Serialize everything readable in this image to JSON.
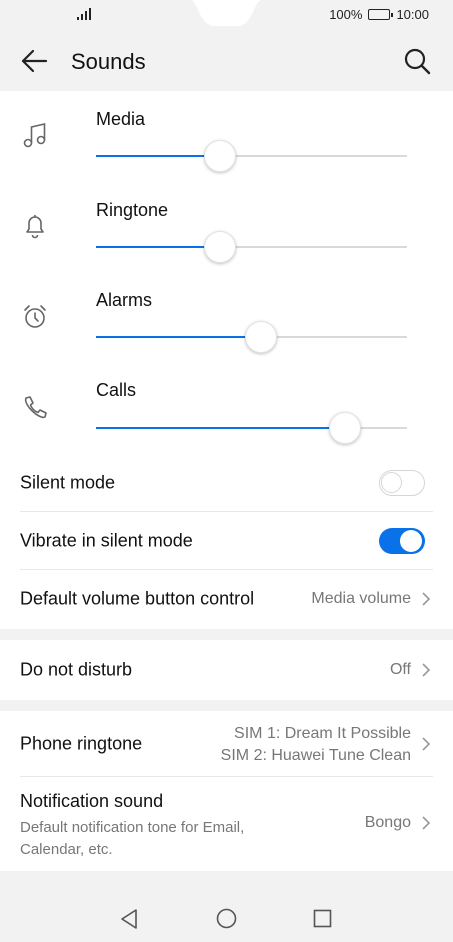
{
  "status_bar": {
    "battery_percent": "100%",
    "time": "10:00"
  },
  "header": {
    "title": "Sounds",
    "back_icon": "back-arrow-icon",
    "search_icon": "search-icon"
  },
  "volume": [
    {
      "label": "Media",
      "icon": "music-note-icon",
      "level": 0.4
    },
    {
      "label": "Ringtone",
      "icon": "bell-icon",
      "level": 0.4
    },
    {
      "label": "Alarms",
      "icon": "alarm-clock-icon",
      "level": 0.53
    },
    {
      "label": "Calls",
      "icon": "phone-icon",
      "level": 0.8
    }
  ],
  "settings": {
    "silent_mode": {
      "label": "Silent mode",
      "enabled": false
    },
    "vibrate_silent": {
      "label": "Vibrate in silent mode",
      "enabled": true
    },
    "default_volume": {
      "label": "Default volume button control",
      "value": "Media volume"
    },
    "do_not_disturb": {
      "label": "Do not disturb",
      "value": "Off"
    },
    "phone_ringtone": {
      "label": "Phone ringtone",
      "sim1": "SIM 1: Dream It Possible",
      "sim2": "SIM 2: Huawei Tune Clean"
    },
    "notification_sound": {
      "label": "Notification sound",
      "description": "Default notification tone for Email, Calendar, etc.",
      "value": "Bongo"
    }
  },
  "colors": {
    "accent": "#0a72e8",
    "background": "#f2f2f2",
    "card": "#ffffff"
  }
}
